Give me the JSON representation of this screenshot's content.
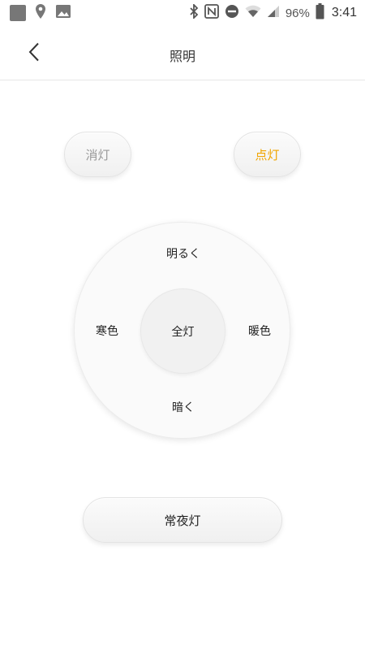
{
  "status_bar": {
    "icons_left": [
      "app-notification-icon",
      "location-icon",
      "image-icon"
    ],
    "icons_right": [
      "bluetooth-icon",
      "nfc-icon",
      "do-not-disturb-icon",
      "wifi-icon",
      "signal-icon",
      "battery-icon"
    ],
    "battery_percent": "96%",
    "time": "3:41"
  },
  "header": {
    "back_icon": "chevron-left-icon",
    "title": "照明"
  },
  "controls": {
    "off_label": "消灯",
    "on_label": "点灯",
    "on_color": "#f0a500",
    "off_color": "#999999"
  },
  "dial": {
    "up_label": "明るく",
    "down_label": "暗く",
    "left_label": "寒色",
    "right_label": "暖色",
    "center_label": "全灯"
  },
  "night_light": {
    "label": "常夜灯"
  }
}
